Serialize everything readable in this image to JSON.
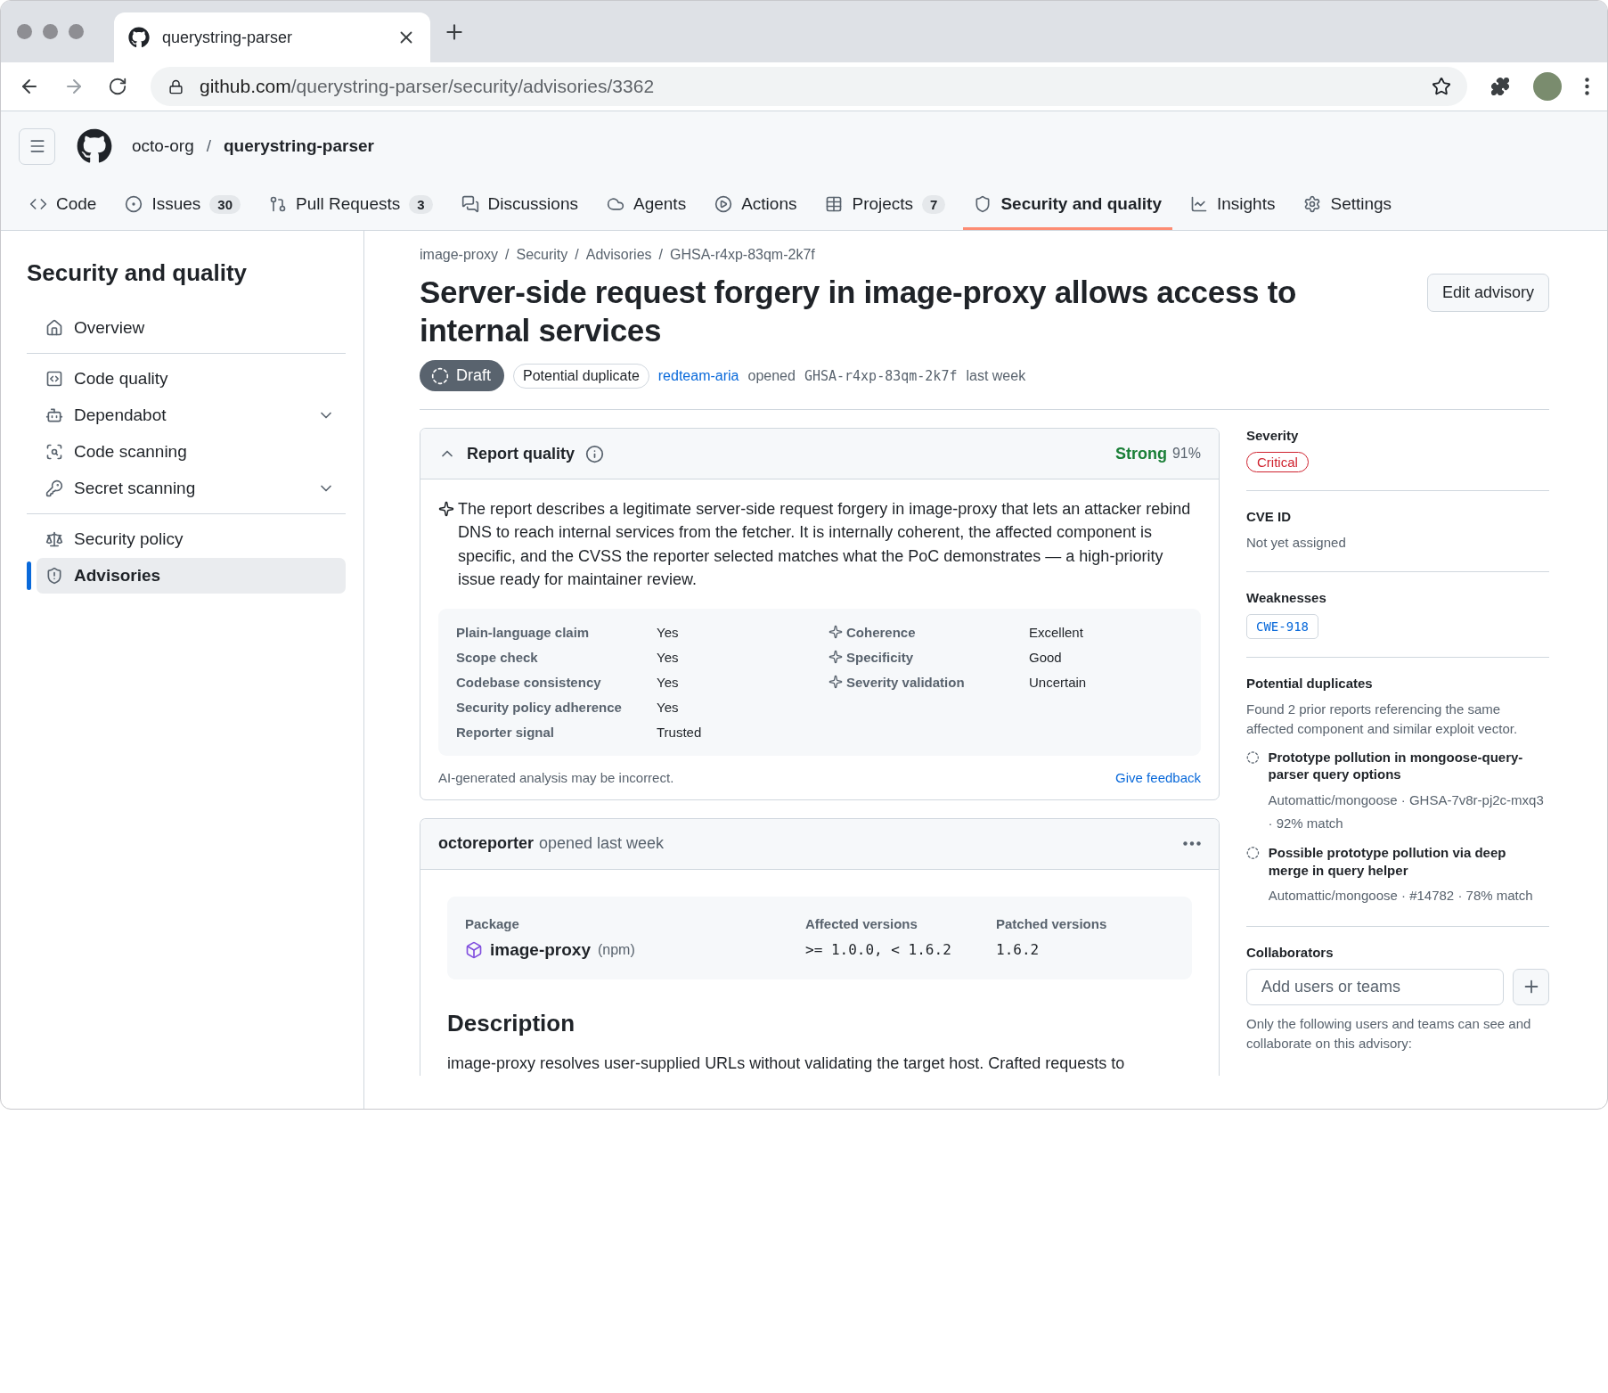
{
  "browser": {
    "tab_title": "querystring-parser",
    "url_host": "github.com",
    "url_path": "/querystring-parser/security/advisories/3362"
  },
  "repo": {
    "owner": "octo-org",
    "separator": "/",
    "name": "querystring-parser"
  },
  "nav": [
    {
      "label": "Code",
      "selected": false
    },
    {
      "label": "Issues",
      "count": "30",
      "selected": false
    },
    {
      "label": "Pull Requests",
      "count": "3",
      "selected": false
    },
    {
      "label": "Discussions",
      "selected": false
    },
    {
      "label": "Agents",
      "selected": false
    },
    {
      "label": "Actions",
      "selected": false
    },
    {
      "label": "Projects",
      "count": "7",
      "selected": false
    },
    {
      "label": "Security and quality",
      "selected": true
    },
    {
      "label": "Insights",
      "selected": false
    },
    {
      "label": "Settings",
      "selected": false
    }
  ],
  "sidebar": {
    "title": "Security and quality",
    "groups": [
      [
        {
          "label": "Overview",
          "expandable": false,
          "selected": false
        }
      ],
      [
        {
          "label": "Code quality",
          "expandable": false,
          "selected": false
        },
        {
          "label": "Dependabot",
          "expandable": true,
          "selected": false
        },
        {
          "label": "Code scanning",
          "expandable": false,
          "selected": false
        },
        {
          "label": "Secret scanning",
          "expandable": true,
          "selected": false
        }
      ],
      [
        {
          "label": "Security policy",
          "expandable": false,
          "selected": false
        },
        {
          "label": "Advisories",
          "expandable": false,
          "selected": true
        }
      ]
    ]
  },
  "breadcrumbs": [
    "image-proxy",
    "Security",
    "Advisories",
    "GHSA-r4xp-83qm-2k7f"
  ],
  "title": "Server-side request forgery in image-proxy allows access to internal services",
  "edit_button": "Edit advisory",
  "status": {
    "state": "Draft",
    "duplicate_badge": "Potential duplicate",
    "author": "redteam-aria",
    "opened": "opened",
    "ghsa": "GHSA-r4xp-83qm-2k7f",
    "when": "last week"
  },
  "report_quality": {
    "title": "Report quality",
    "expanded": true,
    "rating": "Strong",
    "score": "91%",
    "summary": "The report describes a legitimate server-side request forgery in image-proxy that lets an attacker rebind DNS to reach internal services from the fetcher. It is internally coherent, the affected component is specific, and the CVSS the reporter selected matches what the PoC demonstrates — a high-priority issue ready for maintainer review.",
    "checks": [
      {
        "label": "Plain-language claim",
        "value": "Yes"
      },
      {
        "label": "Scope check",
        "value": "Yes"
      },
      {
        "label": "Codebase consistency",
        "value": "Yes"
      },
      {
        "label": "Security policy adherence",
        "value": "Yes"
      },
      {
        "label": "Reporter signal",
        "value": "Trusted"
      }
    ],
    "ai_checks": [
      {
        "label": "Coherence",
        "value": "Excellent"
      },
      {
        "label": "Specificity",
        "value": "Good"
      },
      {
        "label": "Severity validation",
        "value": "Uncertain"
      }
    ],
    "disclaimer": "AI-generated analysis may be incorrect.",
    "feedback": "Give feedback"
  },
  "comment": {
    "author": "octoreporter",
    "meta": "opened last week",
    "package_header": "Package",
    "affected_header": "Affected versions",
    "patched_header": "Patched versions",
    "package": "image-proxy",
    "ecosystem": "(npm)",
    "affected": ">= 1.0.0, < 1.6.2",
    "patched": "1.6.2",
    "description_heading": "Description",
    "description": "image-proxy resolves user-supplied URLs without validating the target host. Crafted requests to"
  },
  "details": {
    "severity_label": "Severity",
    "severity": "Critical",
    "cve_label": "CVE ID",
    "cve": "Not yet assigned",
    "weaknesses_label": "Weaknesses",
    "weakness": "CWE-918",
    "duplicates_label": "Potential duplicates",
    "duplicates_intro": "Found 2 prior reports referencing the same affected component and similar exploit vector.",
    "duplicates": [
      {
        "title": "Prototype pollution in mongoose-query-parser query options",
        "meta": "Automattic/mongoose · GHSA-7v8r-pj2c-mxq3 · 92% match"
      },
      {
        "title": "Possible prototype pollution via deep merge in query helper",
        "meta": "Automattic/mongoose · #14782 · 78% match"
      }
    ],
    "collaborators_label": "Collaborators",
    "collaborators_placeholder": "Add users or teams",
    "collaborators_note": "Only the following users and teams can see and collaborate on this advisory:"
  }
}
